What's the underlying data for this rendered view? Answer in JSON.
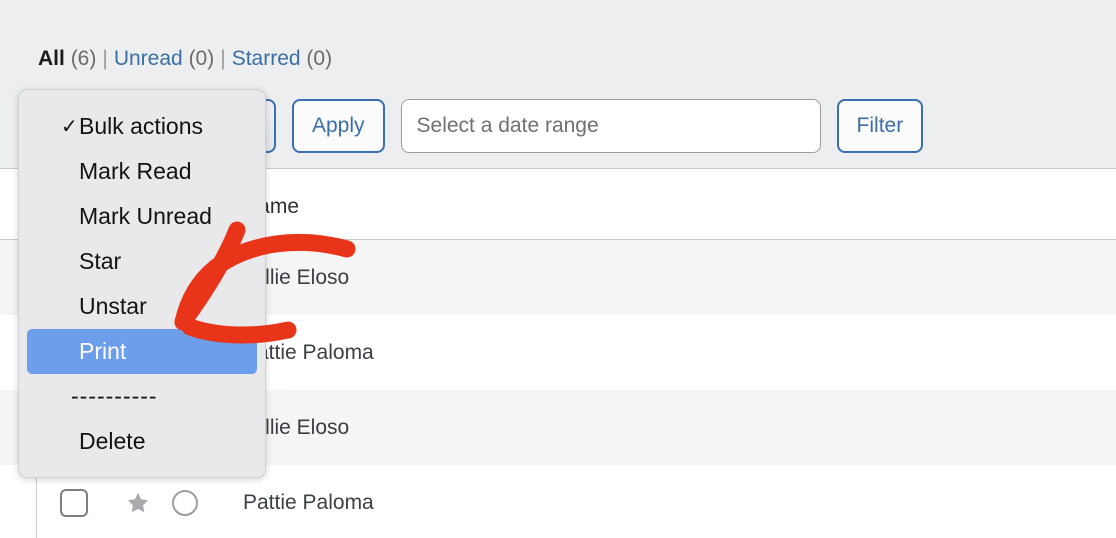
{
  "view_filters": {
    "separator": "|",
    "items": [
      {
        "label": "All",
        "count": "(6)",
        "active": true,
        "is_link": false
      },
      {
        "label": "Unread",
        "count": "(0)",
        "active": false,
        "is_link": true
      },
      {
        "label": "Starred",
        "count": "(0)",
        "active": false,
        "is_link": true
      }
    ]
  },
  "toolbar": {
    "bulk_select_value": "Bulk actions",
    "apply_label": "Apply",
    "date_range_placeholder": "Select a date range",
    "date_range_value": "",
    "filter_label": "Filter"
  },
  "dropdown": {
    "open": true,
    "checkmark": "✓",
    "items": [
      {
        "label": "Bulk actions",
        "checked": true,
        "selected": false,
        "type": "option"
      },
      {
        "label": "Mark Read",
        "checked": false,
        "selected": false,
        "type": "option"
      },
      {
        "label": "Mark Unread",
        "checked": false,
        "selected": false,
        "type": "option"
      },
      {
        "label": "Star",
        "checked": false,
        "selected": false,
        "type": "option"
      },
      {
        "label": "Unstar",
        "checked": false,
        "selected": false,
        "type": "option"
      },
      {
        "label": "Print",
        "checked": false,
        "selected": true,
        "type": "option"
      },
      {
        "label": "----------",
        "checked": false,
        "selected": false,
        "type": "separator"
      },
      {
        "label": "Delete",
        "checked": false,
        "selected": false,
        "type": "option"
      }
    ]
  },
  "table": {
    "columns": [
      "",
      "",
      "",
      "Name"
    ],
    "name_header": "Name",
    "rows": [
      {
        "name": "Millie Eloso",
        "checked": false,
        "starred": true,
        "unread": false,
        "striped": true
      },
      {
        "name": "Pattie Paloma",
        "checked": false,
        "starred": true,
        "unread": false,
        "striped": false
      },
      {
        "name": "Millie Eloso",
        "checked": false,
        "starred": true,
        "unread": false,
        "striped": true
      },
      {
        "name": "Pattie Paloma",
        "checked": false,
        "starred": true,
        "unread": false,
        "striped": false
      }
    ]
  },
  "annotation": {
    "type": "arrow",
    "color": "#e8351a",
    "points_to": "Print",
    "description": "curved red arrow pointing to the Print menu item"
  },
  "colors": {
    "accent_blue": "#3a6ea5",
    "selection_blue": "#6d9eeb",
    "annotation_red": "#e8351a",
    "toolbar_background": "#edeeef",
    "menu_background": "#e9e9ec",
    "row_stripe": "#f4f5f5"
  }
}
